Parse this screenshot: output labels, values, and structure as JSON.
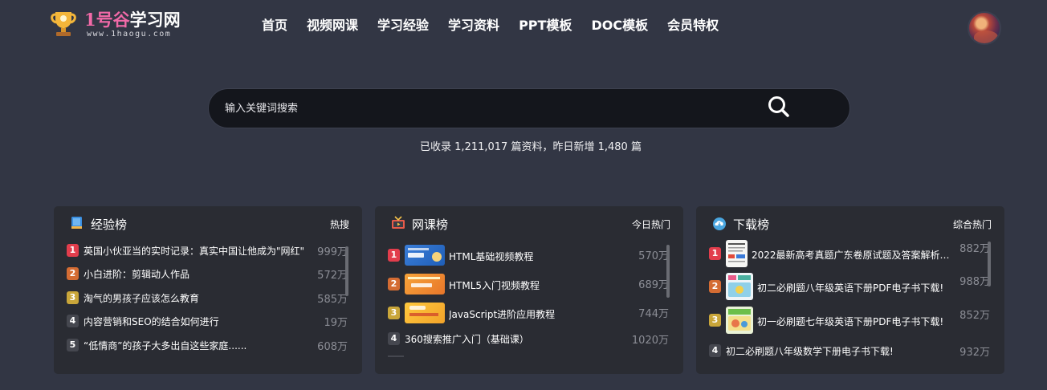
{
  "header": {
    "logo_text_number": "1号谷",
    "logo_text_name": "学习网",
    "logo_url": "www.1haogu.com",
    "nav": [
      "首页",
      "视频网课",
      "学习经验",
      "学习资料",
      "PPT模板",
      "DOC模板",
      "会员特权"
    ]
  },
  "search": {
    "placeholder": "输入关键词搜索"
  },
  "stats_text": "已收录 1,211,017 篇资料，昨日新增 1,480 篇",
  "panels": [
    {
      "title": "经验榜",
      "tag": "热搜",
      "icon": "book-icon",
      "items": [
        {
          "rank": "1",
          "title": "英国小伙亚当的实时记录：真实中国让他成为\"网红\"",
          "count": "999万"
        },
        {
          "rank": "2",
          "title": "小白进阶：剪辑动人作品",
          "count": "572万"
        },
        {
          "rank": "3",
          "title": "淘气的男孩子应该怎么教育",
          "count": "585万"
        },
        {
          "rank": "4",
          "title": "内容营销和SEO的结合如何进行",
          "count": "19万"
        },
        {
          "rank": "5",
          "title": "“低情商”的孩子大多出自这些家庭......",
          "count": "608万"
        }
      ]
    },
    {
      "title": "网课榜",
      "tag": "今日热门",
      "icon": "video-icon",
      "items": [
        {
          "rank": "1",
          "title": "HTML基础视频教程",
          "count": "570万"
        },
        {
          "rank": "2",
          "title": "HTML5入门视频教程",
          "count": "689万"
        },
        {
          "rank": "3",
          "title": "JavaScript进阶应用教程",
          "count": "744万"
        },
        {
          "rank": "4",
          "title": "360搜索推广入门（基础课）",
          "count": "1020万"
        }
      ]
    },
    {
      "title": "下载榜",
      "tag": "综合热门",
      "icon": "cloud-download-icon",
      "items": [
        {
          "rank": "1",
          "title": "2022最新高考真题广东卷原试题及答案解析（...",
          "count": "882万"
        },
        {
          "rank": "2",
          "title": "初二必刷题八年级英语下册PDF电子书下载!",
          "count": "988万"
        },
        {
          "rank": "3",
          "title": "初一必刷题七年级英语下册PDF电子书下载!",
          "count": "852万"
        },
        {
          "rank": "4",
          "title": "初二必刷题八年级数学下册电子书下载!",
          "count": "932万"
        }
      ]
    }
  ],
  "colors": {
    "background": "#323644",
    "panel": "#2a2c33",
    "rank1": "#e23d4c",
    "rank2": "#d46c33",
    "rank3": "#c9a63a",
    "logo_pink": "#f26aa8"
  }
}
